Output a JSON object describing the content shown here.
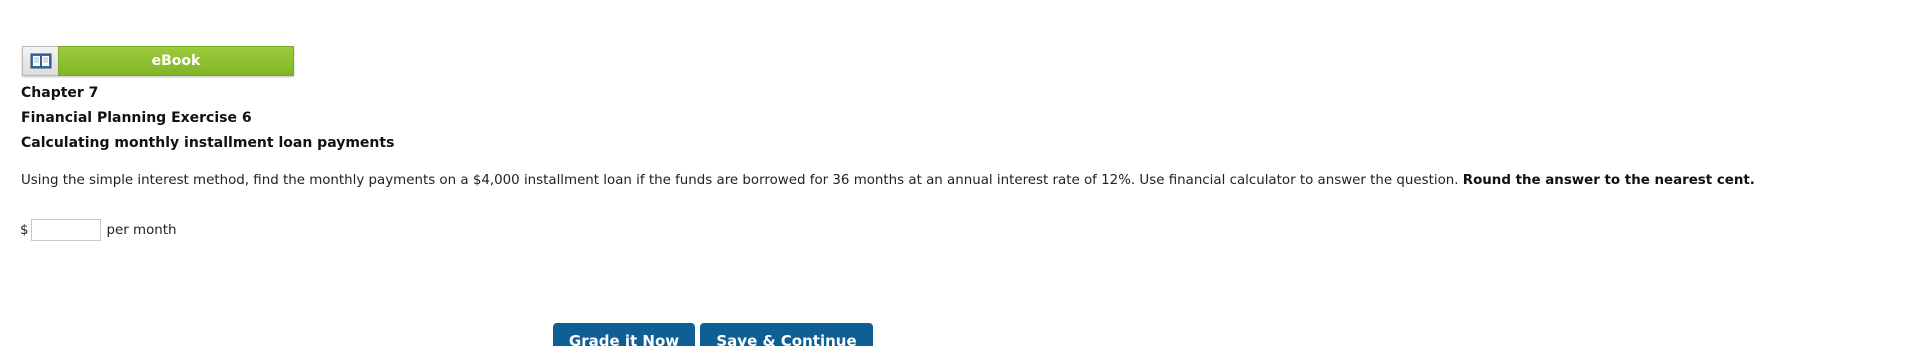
{
  "ebook": {
    "label": "eBook",
    "icon": "book-icon"
  },
  "headings": {
    "chapter": "Chapter 7",
    "exercise": "Financial Planning Exercise 6",
    "topic": "Calculating monthly installment loan payments"
  },
  "question": {
    "text": "Using the simple interest method, find the monthly payments on a $4,000 installment loan if the funds are borrowed for 36 months at an annual interest rate of 12%. Use financial calculator to answer the question. ",
    "emphasis": "Round the answer to the nearest cent."
  },
  "answer": {
    "prefix": "$",
    "value": "",
    "suffix": "per month"
  },
  "actions": {
    "grade_label": "Grade it Now",
    "save_label": "Save & Continue"
  },
  "colors": {
    "ebook_green": "#8dc033",
    "button_blue": "#0e5f94"
  }
}
